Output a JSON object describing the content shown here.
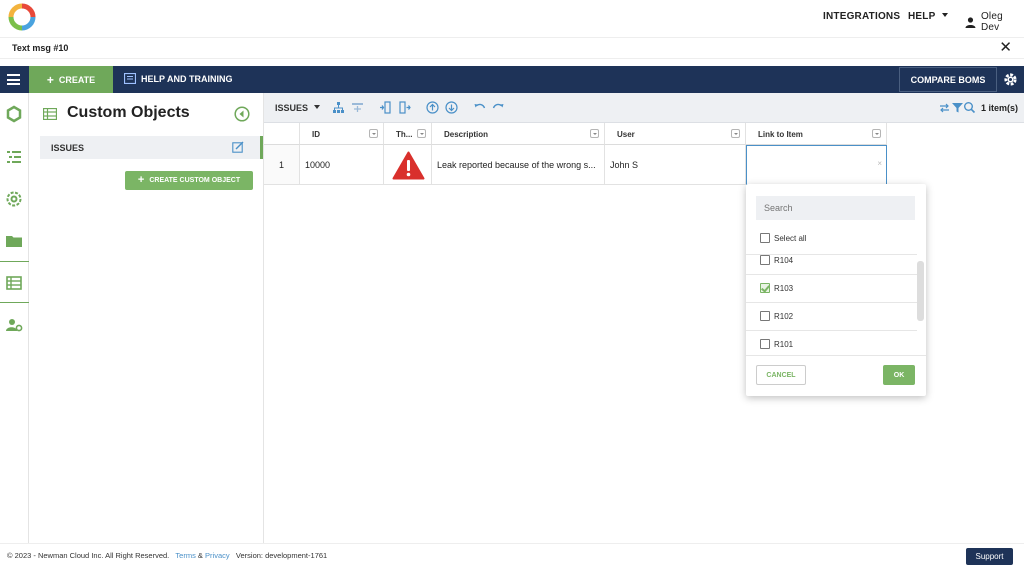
{
  "header": {
    "integrations_label": "INTEGRATIONS",
    "help_label": "HELP",
    "user_name": "Oleg Dev"
  },
  "message_bar": {
    "title": "Text msg #10",
    "close_glyph": "✕"
  },
  "navbar": {
    "create_label": "CREATE",
    "help_training_label": "HELP AND TRAINING",
    "compare_boms_label": "COMPARE BOMS"
  },
  "left_panel": {
    "title": "Custom Objects",
    "items": [
      {
        "label": "ISSUES"
      }
    ],
    "create_button_label": "CREATE CUSTOM OBJECT"
  },
  "toolbar": {
    "view_label": "ISSUES",
    "item_count": "1 item(s)"
  },
  "grid": {
    "columns": [
      {
        "label": "ID"
      },
      {
        "label": "Th..."
      },
      {
        "label": "Description"
      },
      {
        "label": "User"
      },
      {
        "label": "Link to Item"
      }
    ],
    "rows": [
      {
        "row_number": "1",
        "id": "10000",
        "thumbnail": "warning-icon",
        "description": "Leak reported because of the wrong s...",
        "user": "John S",
        "link_to_item": ""
      }
    ]
  },
  "link_dropdown": {
    "search_placeholder": "Search",
    "select_all_label": "Select all",
    "options": [
      {
        "label": "R104",
        "checked": false
      },
      {
        "label": "R103",
        "checked": true
      },
      {
        "label": "R102",
        "checked": false
      },
      {
        "label": "R101",
        "checked": false
      }
    ],
    "cancel_label": "CANCEL",
    "ok_label": "OK"
  },
  "footer": {
    "copyright": "© 2023 - Newman Cloud Inc. All Right Reserved.",
    "terms_label": "Terms",
    "ampersand": "&",
    "privacy_label": "Privacy",
    "version_text": "Version: development-1761",
    "support_label": "Support"
  },
  "colors": {
    "navy": "#1e3358",
    "green": "#6fa85a",
    "warning_red": "#d9302c"
  }
}
